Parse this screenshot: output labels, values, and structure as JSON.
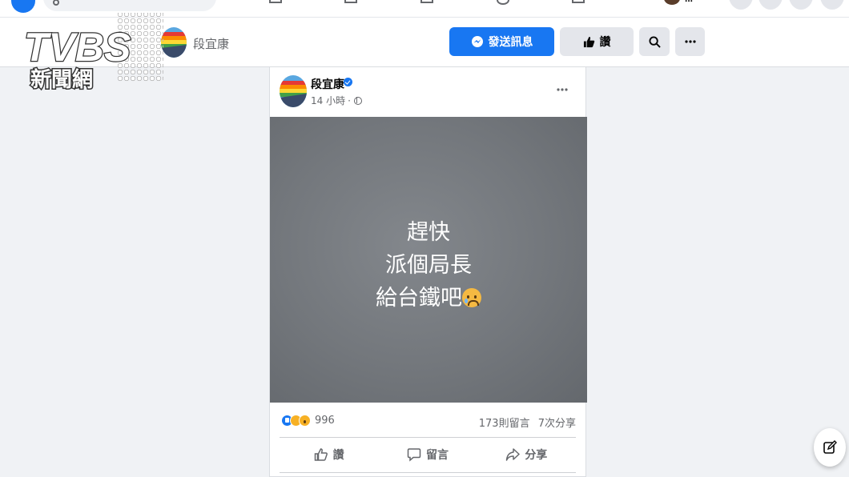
{
  "top_nav": {
    "user_name": "..."
  },
  "profile_header": {
    "name": "段宜康",
    "message_button": "發送訊息",
    "like_button": "讚",
    "search_icon": "search-icon",
    "more_icon": "more-horizontal-icon"
  },
  "watermark": {
    "brand": "TVBS",
    "subtitle": "新聞網"
  },
  "post": {
    "author": "段宜康",
    "verified": true,
    "time": "14 小時",
    "privacy_icon": "globe-icon",
    "image_text": {
      "line1": "趕快",
      "line2": "派個局長",
      "line3": "給台鐵吧"
    },
    "reactions": {
      "types": [
        "like",
        "sad",
        "wow"
      ],
      "count": "996"
    },
    "comments": "173則留言",
    "shares": "7次分享",
    "actions": {
      "like": "讚",
      "comment": "留言",
      "share": "分享"
    }
  },
  "colors": {
    "brand_blue": "#1877f2",
    "page_bg": "#f0f2f5",
    "secondary_text": "#65676b"
  }
}
